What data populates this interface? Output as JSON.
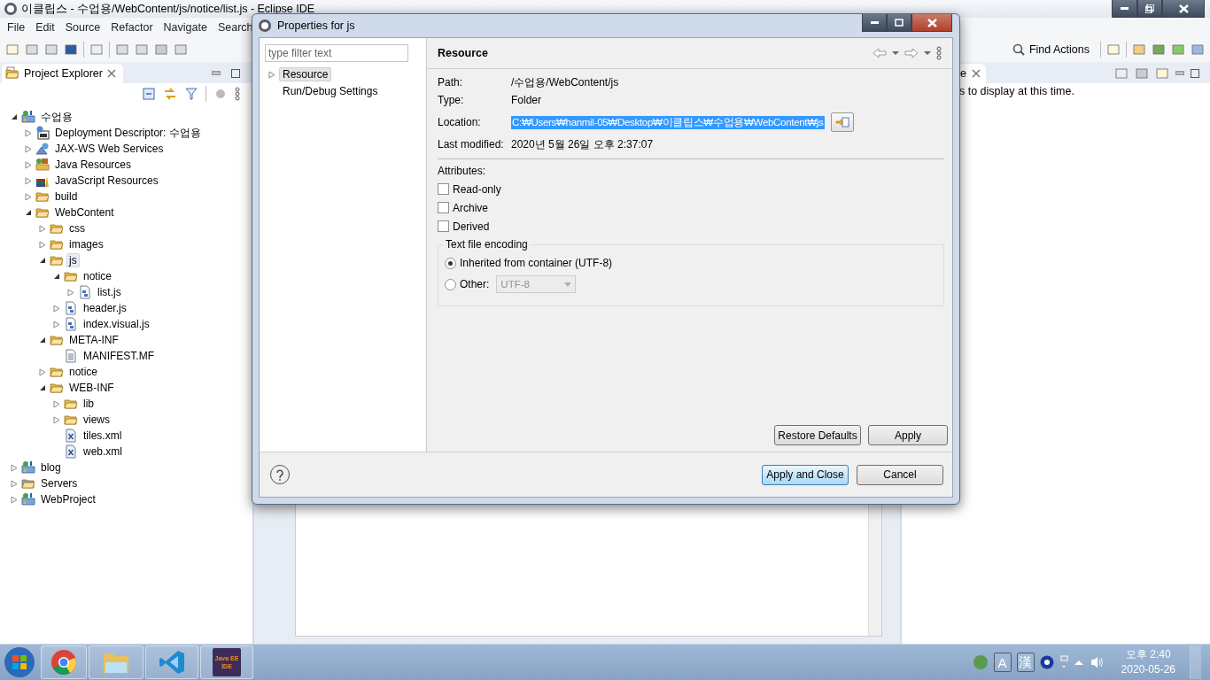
{
  "window": {
    "title": "이클립스 - 수업용/WebContent/js/notice/list.js - Eclipse IDE"
  },
  "menu": [
    "File",
    "Edit",
    "Source",
    "Refactor",
    "Navigate",
    "Search"
  ],
  "find_actions": "Find Actions",
  "project_explorer": {
    "title": "Project Explorer",
    "tree": [
      {
        "label": "수업용",
        "kind": "project",
        "expanded": true,
        "selected": false,
        "children": [
          {
            "label": "Deployment Descriptor: 수업용",
            "kind": "descriptor",
            "expanded": false,
            "selected": false
          },
          {
            "label": "JAX-WS Web Services",
            "kind": "services",
            "expanded": false,
            "selected": false
          },
          {
            "label": "Java Resources",
            "kind": "java",
            "expanded": false,
            "selected": false
          },
          {
            "label": "JavaScript Resources",
            "kind": "books",
            "expanded": false,
            "selected": false
          },
          {
            "label": "build",
            "kind": "folder",
            "expanded": false,
            "selected": false
          },
          {
            "label": "WebContent",
            "kind": "folder",
            "expanded": true,
            "selected": false,
            "children": [
              {
                "label": "css",
                "kind": "folder",
                "expanded": false,
                "selected": false
              },
              {
                "label": "images",
                "kind": "folder",
                "expanded": false,
                "selected": false
              },
              {
                "label": "js",
                "kind": "folder",
                "expanded": true,
                "selected": true,
                "children": [
                  {
                    "label": "notice",
                    "kind": "folder",
                    "expanded": true,
                    "selected": false,
                    "children": [
                      {
                        "label": "list.js",
                        "kind": "script",
                        "expanded": false,
                        "selected": false
                      }
                    ]
                  },
                  {
                    "label": "header.js",
                    "kind": "script",
                    "expanded": false,
                    "selected": false
                  },
                  {
                    "label": "index.visual.js",
                    "kind": "script",
                    "expanded": false,
                    "selected": false
                  }
                ]
              },
              {
                "label": "META-INF",
                "kind": "folder",
                "expanded": true,
                "selected": false,
                "children": [
                  {
                    "label": "MANIFEST.MF",
                    "kind": "text",
                    "selected": false
                  }
                ]
              },
              {
                "label": "notice",
                "kind": "folder",
                "expanded": false,
                "selected": false
              },
              {
                "label": "WEB-INF",
                "kind": "folder",
                "expanded": true,
                "selected": false,
                "children": [
                  {
                    "label": "lib",
                    "kind": "folder",
                    "expanded": false,
                    "selected": false
                  },
                  {
                    "label": "views",
                    "kind": "folder",
                    "expanded": false,
                    "selected": false
                  },
                  {
                    "label": "tiles.xml",
                    "kind": "xml",
                    "selected": false
                  },
                  {
                    "label": "web.xml",
                    "kind": "xml",
                    "selected": false
                  }
                ]
              }
            ]
          }
        ]
      },
      {
        "label": "blog",
        "kind": "project",
        "expanded": false,
        "selected": false
      },
      {
        "label": "Servers",
        "kind": "folder-blue",
        "expanded": false,
        "selected": false
      },
      {
        "label": "WebProject",
        "kind": "project",
        "expanded": false,
        "selected": false
      }
    ]
  },
  "right_panel": {
    "tab": "e",
    "message": "s to display at this time."
  },
  "dialog": {
    "title": "Properties for js",
    "filter": {
      "placeholder": "type filter text"
    },
    "nav": [
      {
        "label": "Resource",
        "selected": true,
        "expanded": false
      },
      {
        "label": "Run/Debug Settings",
        "selected": false
      }
    ],
    "heading": "Resource",
    "fields": [
      {
        "label": "Path:",
        "value": "/수업용/WebContent/js",
        "kind": "text"
      },
      {
        "label": "Type:",
        "value": "Folder",
        "kind": "text"
      },
      {
        "label": "Location:",
        "value": "C:₩Users₩hanmil-05₩Desktop₩이클립스₩수업용₩WebContent₩js",
        "kind": "location"
      },
      {
        "label": "Last modified:",
        "value": "2020년 5월 26일 오후 2:37:07",
        "kind": "text"
      }
    ],
    "attributes": {
      "title": "Attributes:",
      "items": [
        {
          "label": "Read-only",
          "checked": false
        },
        {
          "label": "Archive",
          "checked": false
        },
        {
          "label": "Derived",
          "checked": false
        }
      ]
    },
    "encoding": {
      "title": "Text file encoding",
      "options": [
        {
          "label": "Inherited from container (UTF-8)",
          "selected": true
        },
        {
          "label": "Other:",
          "selected": false
        }
      ],
      "other_value": "UTF-8"
    },
    "page_buttons": [
      "Restore Defaults",
      "Apply"
    ],
    "buttons": [
      {
        "label": "Apply and Close",
        "default": true
      },
      {
        "label": "Cancel",
        "default": false
      }
    ]
  },
  "taskbar": {
    "app_badge": [
      "Java EE",
      "IDE"
    ],
    "ime": [
      "A",
      "漢"
    ],
    "time": "오후 2:40",
    "date": "2020-05-26"
  }
}
